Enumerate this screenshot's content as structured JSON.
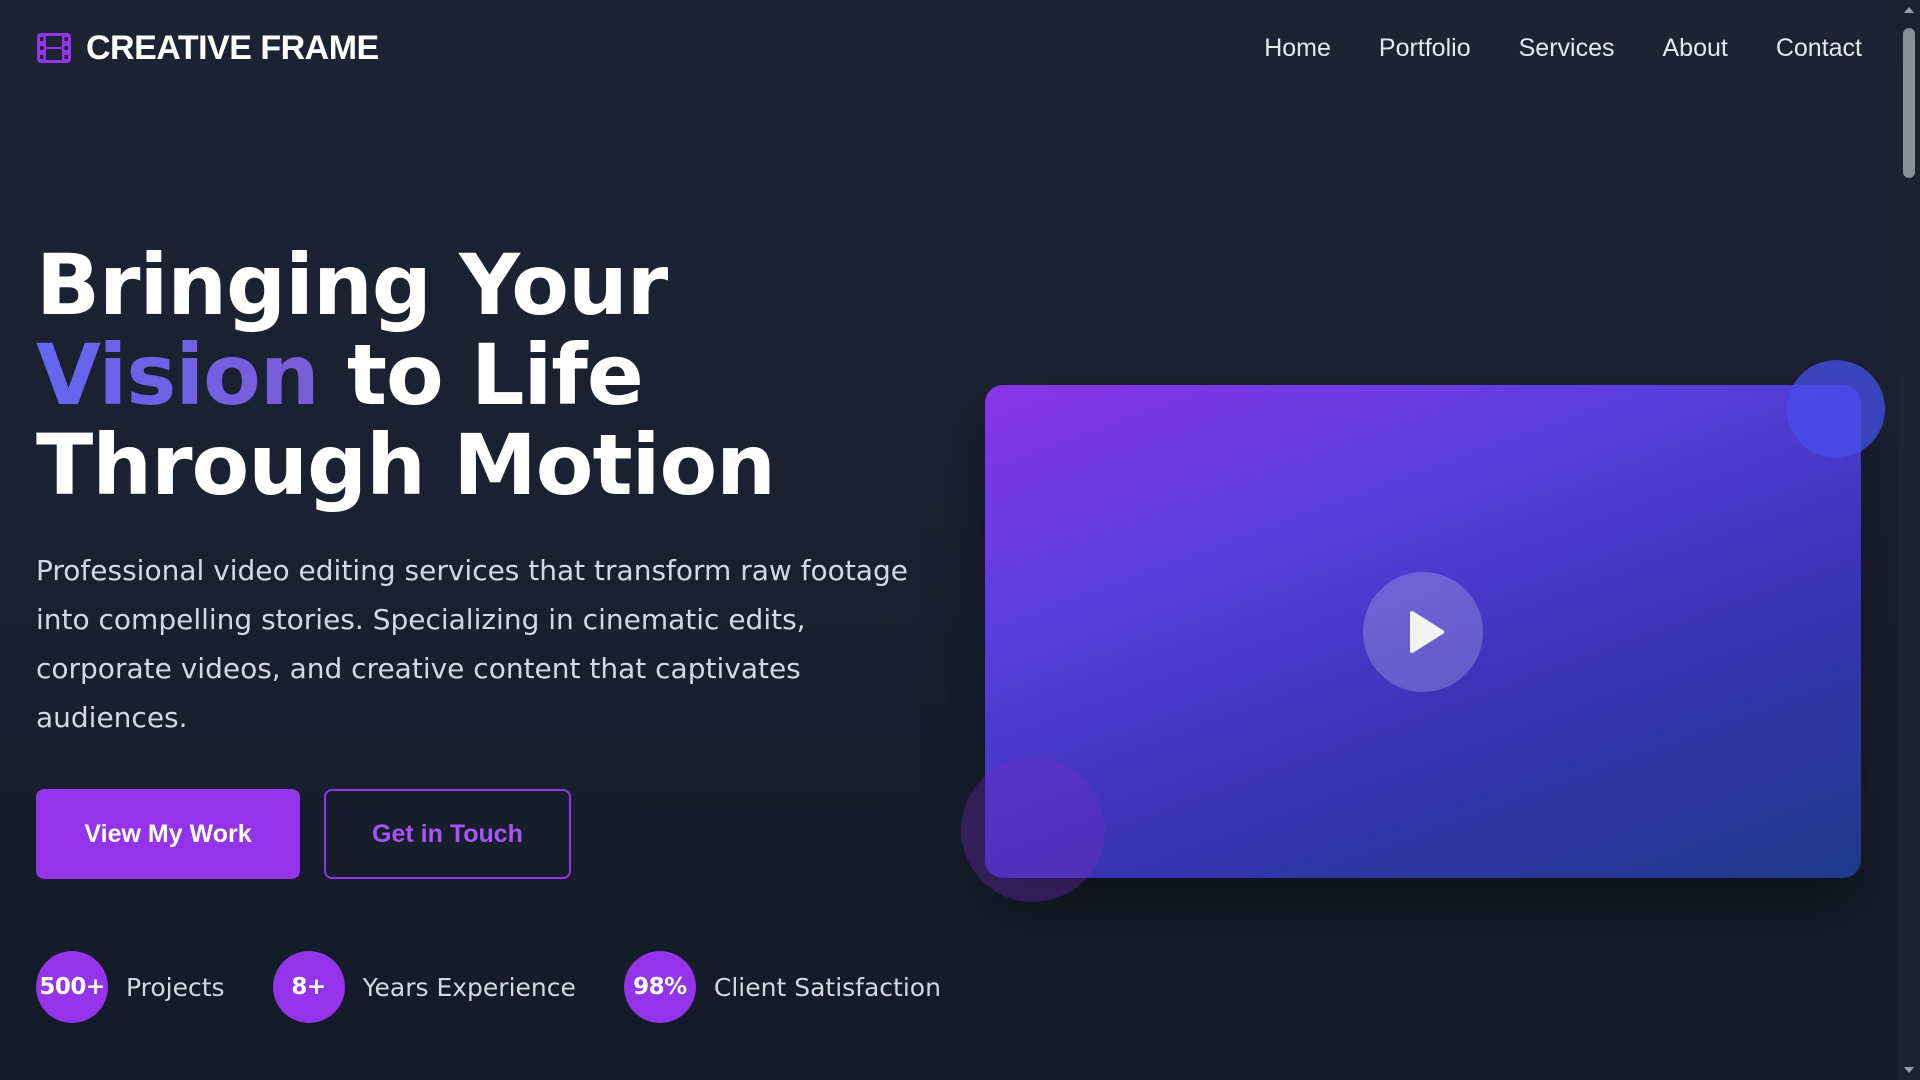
{
  "brand": {
    "name": "CREATIVE FRAME",
    "icon": "film-icon",
    "accent_color": "#9333ea"
  },
  "nav": {
    "items": [
      {
        "label": "Home"
      },
      {
        "label": "Portfolio"
      },
      {
        "label": "Services"
      },
      {
        "label": "About"
      },
      {
        "label": "Contact"
      }
    ]
  },
  "hero": {
    "title_part1": "Bringing Your ",
    "title_accent": "Vision",
    "title_part2": " to Life Through Motion",
    "description": "Professional video editing services that transform raw footage into compelling stories. Specializing in cinematic edits, corporate videos, and creative content that captivates audiences.",
    "primary_button": "View My Work",
    "secondary_button": "Get in Touch"
  },
  "stats": [
    {
      "value": "500+",
      "label": "Projects"
    },
    {
      "value": "8+",
      "label": "Years Experience"
    },
    {
      "value": "98%",
      "label": "Client Satisfaction"
    }
  ],
  "video": {
    "play_icon": "play-icon",
    "gradient_start": "#8b34e8",
    "gradient_end": "#1e3a8a"
  }
}
